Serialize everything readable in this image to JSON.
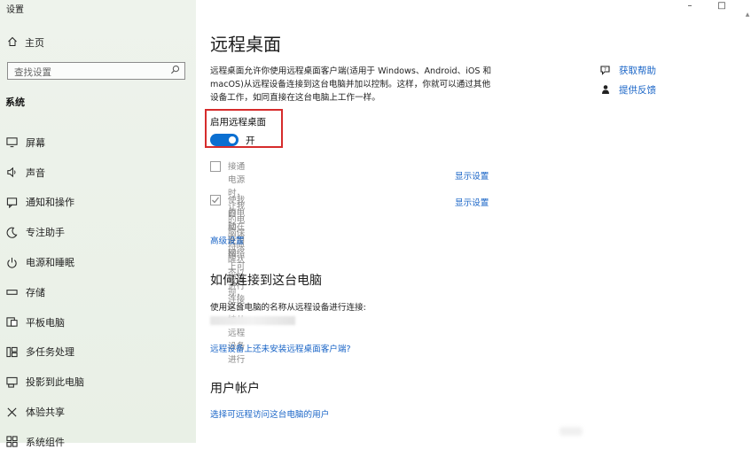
{
  "window": {
    "title": "设置",
    "minimize_glyph": "–",
    "maximize_glyph": "□"
  },
  "sidebar": {
    "home_label": "主页",
    "search_placeholder": "查找设置",
    "section_label": "系统",
    "items": [
      {
        "label": "屏幕",
        "icon": "monitor-icon"
      },
      {
        "label": "声音",
        "icon": "speaker-icon"
      },
      {
        "label": "通知和操作",
        "icon": "notification-icon"
      },
      {
        "label": "专注助手",
        "icon": "moon-icon"
      },
      {
        "label": "电源和睡眠",
        "icon": "power-icon"
      },
      {
        "label": "存储",
        "icon": "storage-icon"
      },
      {
        "label": "平板电脑",
        "icon": "tablet-icon"
      },
      {
        "label": "多任务处理",
        "icon": "multitask-icon"
      },
      {
        "label": "投影到此电脑",
        "icon": "project-icon"
      },
      {
        "label": "体验共享",
        "icon": "share-icon"
      },
      {
        "label": "系统组件",
        "icon": "components-icon"
      }
    ]
  },
  "main": {
    "title": "远程桌面",
    "description": "远程桌面允许你使用远程桌面客户端(适用于 Windows、Android、iOS 和 macOS)从远程设备连接到这台电脑并加以控制。这样，你就可以通过其他设备工作，如同直接在这台电脑上工作一样。",
    "enable": {
      "label": "启用远程桌面",
      "state_label": "开",
      "on": true
    },
    "options": [
      {
        "text": "接通电源时，让我的电脑保持唤醒状态以进行连接",
        "checked": false,
        "link": "显示设置"
      },
      {
        "text_line1": "使我的电脑在专用网络上可被发现，以支持从远程设备进行",
        "text_line2": "自动连接",
        "checked": true,
        "link": "显示设置"
      }
    ],
    "advanced_link": "高级设置",
    "howto_heading": "如何连接到这台电脑",
    "howto_desc": "使用这台电脑的名称从远程设备进行连接:",
    "no_client_link": "远程设备上还未安装远程桌面客户端?",
    "accounts_heading": "用户帐户",
    "select_users_link": "选择可远程访问这台电脑的用户"
  },
  "help": {
    "get_help": "获取帮助",
    "feedback": "提供反馈"
  },
  "colors": {
    "accent": "#0b6fd1",
    "link": "#1a65c7",
    "highlight_border": "#d62c2c",
    "sidebar_bg": "#eef3ec"
  }
}
